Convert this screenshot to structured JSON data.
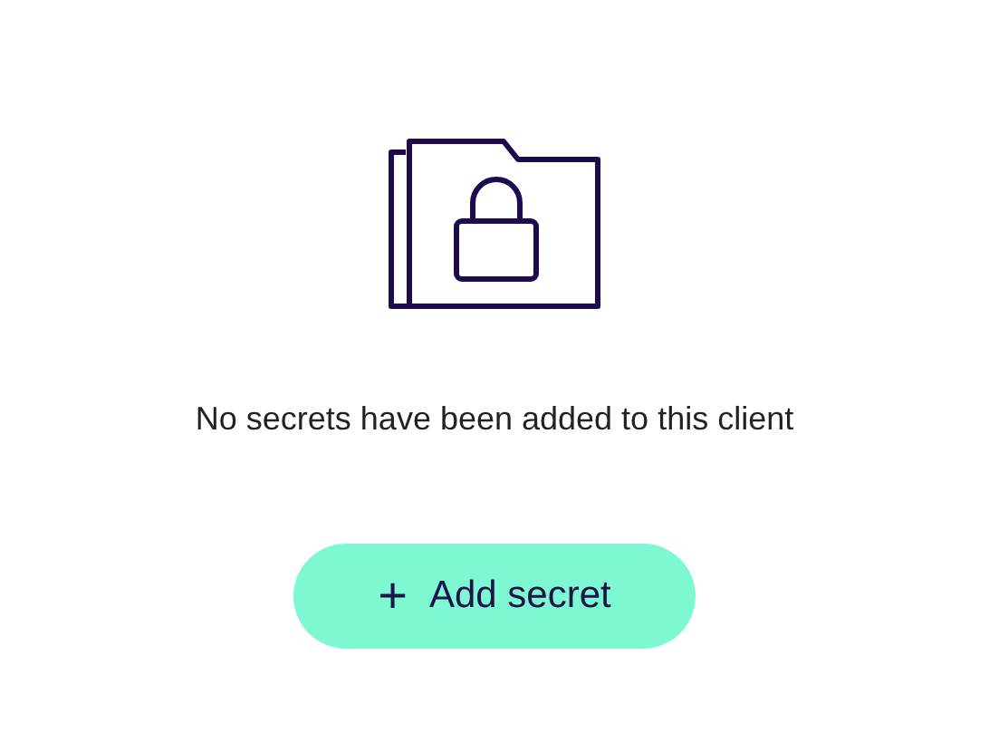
{
  "empty_state": {
    "message": "No secrets have been added to this client"
  },
  "add_button": {
    "icon": "+",
    "label": "Add secret"
  }
}
